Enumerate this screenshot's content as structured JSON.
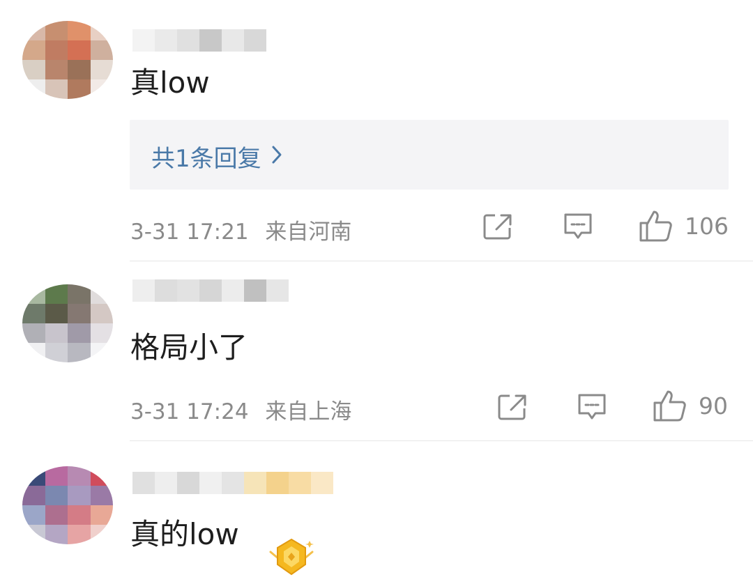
{
  "comments": [
    {
      "text": "真low",
      "reply_summary": "共1条回复",
      "timestamp": "3-31 17:21",
      "location": "来自河南",
      "likes": "106",
      "avatar_colors": [
        "#d8b8a8",
        "#c78f70",
        "#e0916a",
        "#e8d0c4",
        "#d4a88a",
        "#c07c62",
        "#d47054",
        "#cfb09e",
        "#d9cfc4",
        "#b9856c",
        "#9a7158",
        "#e6dcd4",
        "#eee",
        "#d8c4b8",
        "#b07a5e",
        "#f2eae6"
      ],
      "username_colors": [
        "#f3f3f3",
        "#eaeaea",
        "#e0e0e0",
        "#c8c8c8",
        "#e8e8e8",
        "#d8d8d8"
      ]
    },
    {
      "text": "格局小了",
      "timestamp": "3-31 17:24",
      "location": "来自上海",
      "likes": "90",
      "avatar_colors": [
        "#a8b8a0",
        "#5d7a4c",
        "#7a7468",
        "#e0dcdc",
        "#6e7a6a",
        "#5b5a48",
        "#857872",
        "#d4c8c4",
        "#b0b0b6",
        "#c8c4cc",
        "#a09aa8",
        "#e4e0e4",
        "#f0f0f2",
        "#d0d0d6",
        "#b8b8c0",
        "#f4f4f6"
      ],
      "username_colors": [
        "#eeeeee",
        "#dddddd",
        "#e2e2e2",
        "#d6d6d6",
        "#ececec",
        "#c0c0c0",
        "#e6e6e6"
      ]
    },
    {
      "text": "真的low",
      "avatar_colors": [
        "#3a4a78",
        "#b86aa0",
        "#b78ab2",
        "#d04c5c",
        "#8a6a98",
        "#7b88b0",
        "#a89ac0",
        "#9a7aa6",
        "#9ba6c8",
        "#ad6f8f",
        "#d47c86",
        "#e8a896",
        "#c8c8d4",
        "#b4a6c4",
        "#e6a4a4",
        "#f0d0cc"
      ],
      "username_colors": [
        "#e0e0e0",
        "#eeeeee",
        "#d8d8d8",
        "#f0f0f0",
        "#e4e4e4",
        "#f6e4b8",
        "#f4d28c",
        "#f8dca4",
        "#fae8c6"
      ]
    }
  ],
  "colors": {
    "link": "#4a79a8",
    "meta": "#8a8a8a",
    "reply_bg": "#f4f4f6",
    "badge_gold": "#f5b820"
  },
  "icons": [
    "share-icon",
    "comment-icon",
    "like-icon",
    "badge-icon"
  ]
}
